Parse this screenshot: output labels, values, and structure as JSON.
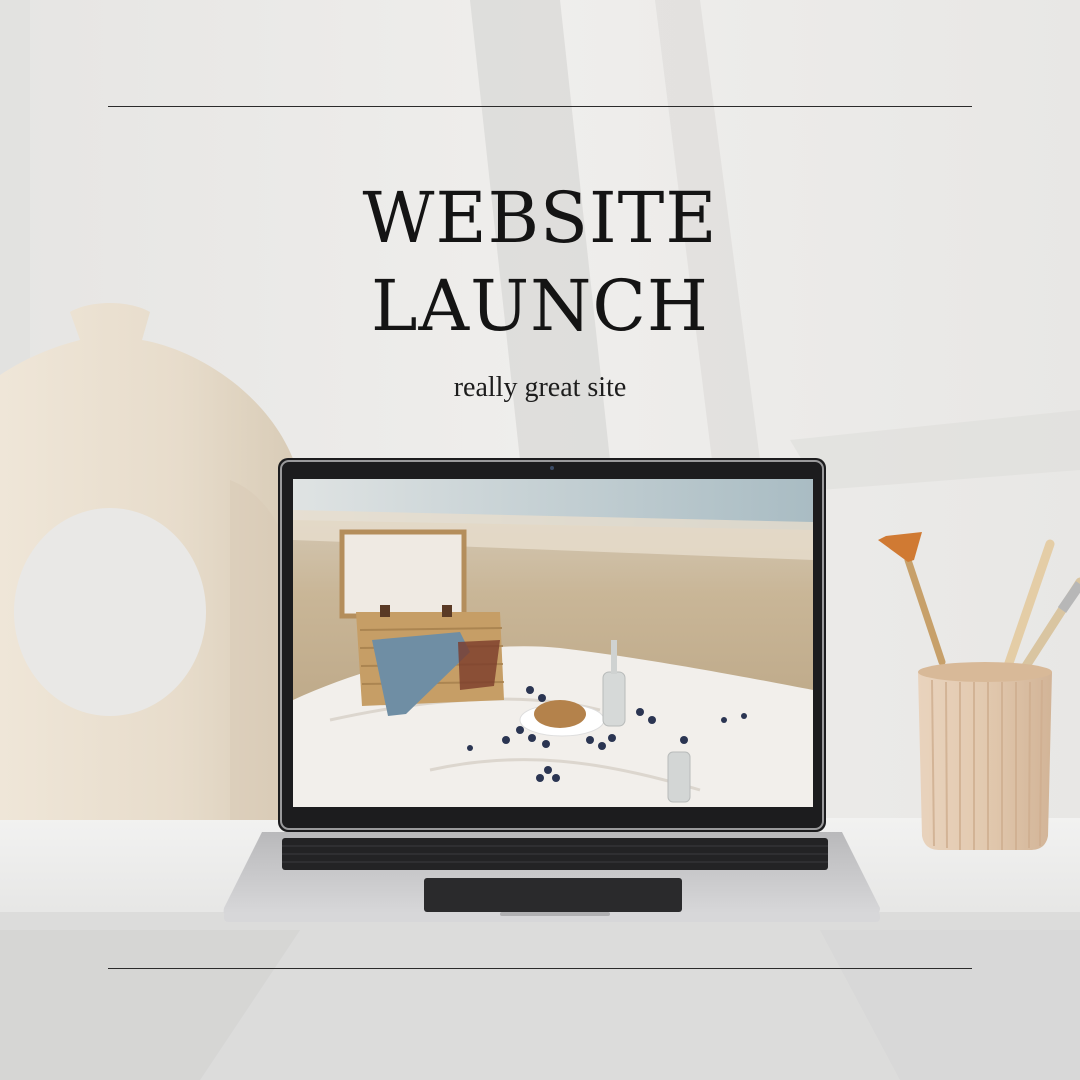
{
  "headline": {
    "line1": "WEBSITE",
    "line2": "LAUNCH"
  },
  "tagline": "really great site",
  "colors": {
    "background": "#ecebe9",
    "ink": "#141414",
    "vase": "#eadfce",
    "pot": "#e2c8ae",
    "laptop": "#c9c9cb"
  }
}
